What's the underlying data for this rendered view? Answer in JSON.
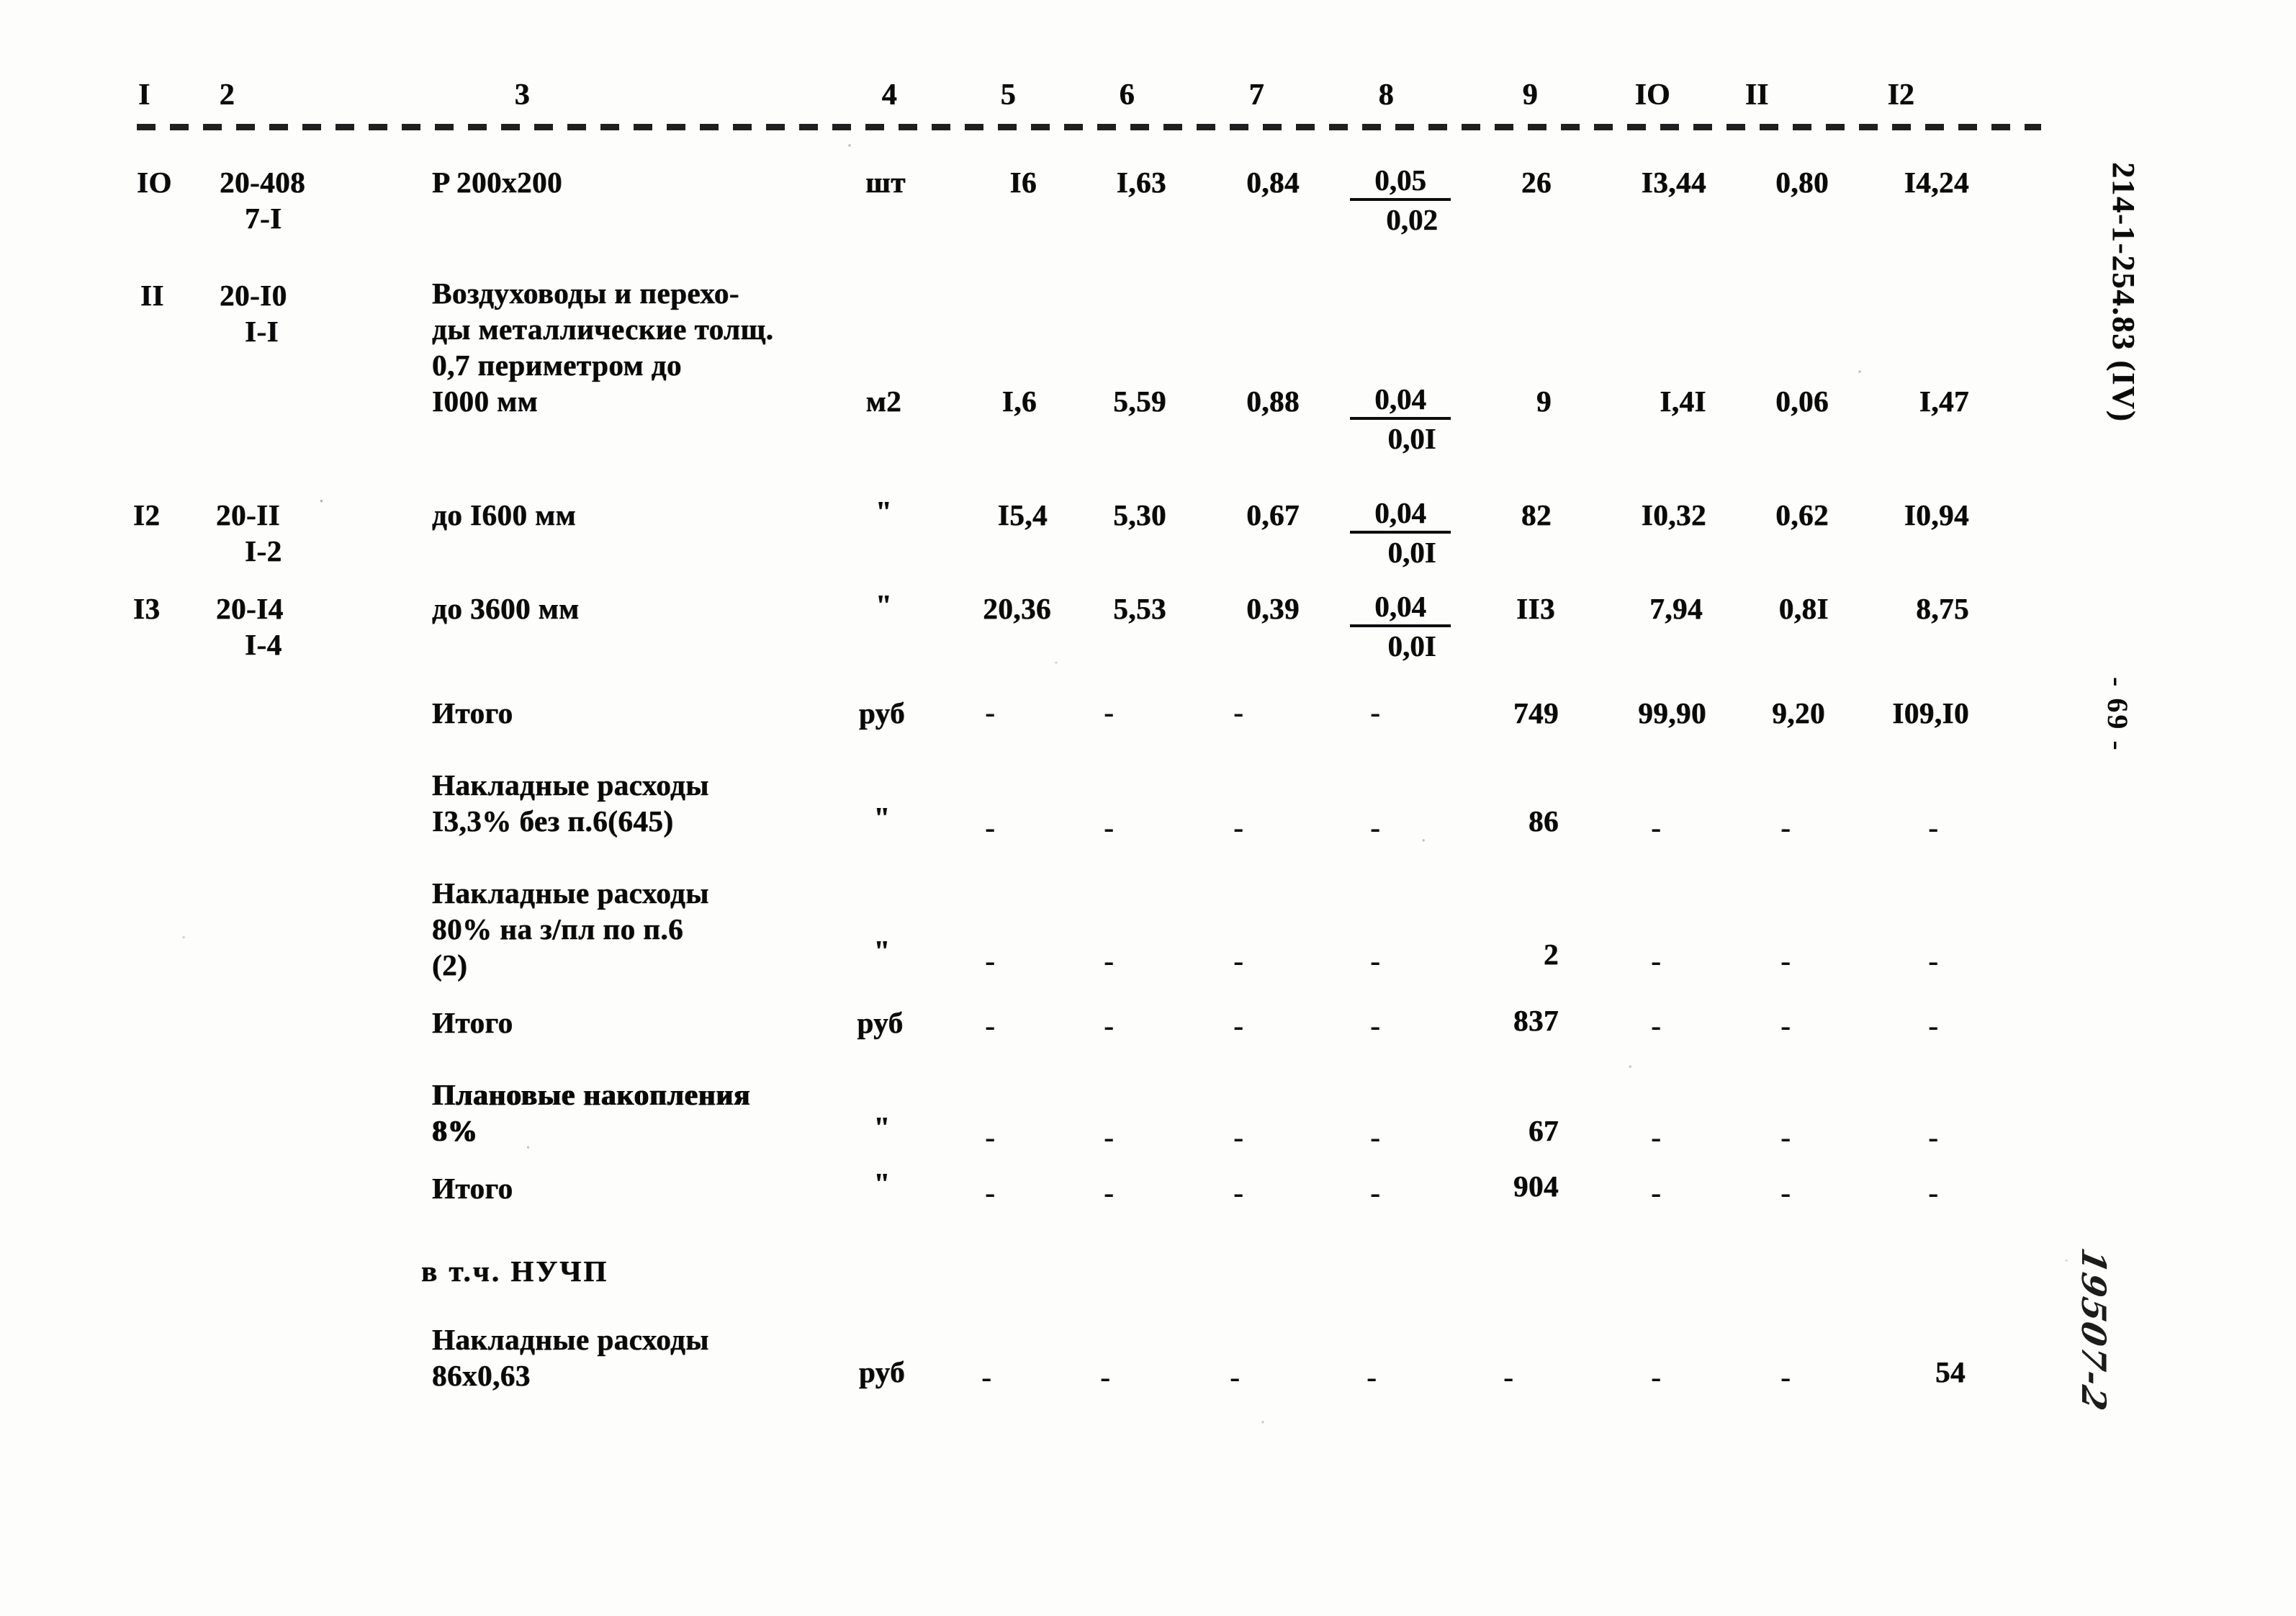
{
  "document": {
    "side_code": "214-1-254.83 (IV)",
    "page_marker": "- 69 -",
    "handwritten_note": "19507-2"
  },
  "table": {
    "column_headers": [
      "I",
      "2",
      "3",
      "4",
      "5",
      "6",
      "7",
      "8",
      "9",
      "IO",
      "II",
      "I2"
    ],
    "rows": [
      {
        "no": "IO",
        "code_line1": "20-408",
        "code_line2": "7-I",
        "name": [
          "P 200x200"
        ],
        "unit": "шт",
        "c5": "I6",
        "c6": "I,63",
        "c7": "0,84",
        "c8_top": "0,05",
        "c8_bot": "0,02",
        "c9": "26",
        "c10": "I3,44",
        "c11": "0,80",
        "c12": "I4,24"
      },
      {
        "no": "II",
        "code_line1": "20-I0",
        "code_line2": "I-I",
        "name": [
          "Воздуховоды и перехо-",
          "ды металлические толщ.",
          "0,7 периметром до",
          "I000 мм"
        ],
        "unit": "м2",
        "c5": "I,6",
        "c6": "5,59",
        "c7": "0,88",
        "c8_top": "0,04",
        "c8_bot": "0,0I",
        "c9": "9",
        "c10": "I,4I",
        "c11": "0,06",
        "c12": "I,47"
      },
      {
        "no": "I2",
        "code_line1": "20-II",
        "code_line2": "I-2",
        "name": [
          "до I600 мм"
        ],
        "unit": "\"",
        "c5": "I5,4",
        "c6": "5,30",
        "c7": "0,67",
        "c8_top": "0,04",
        "c8_bot": "0,0I",
        "c9": "82",
        "c10": "I0,32",
        "c11": "0,62",
        "c12": "I0,94"
      },
      {
        "no": "I3",
        "code_line1": "20-I4",
        "code_line2": "I-4",
        "name": [
          "до 3600 мм"
        ],
        "unit": "\"",
        "c5": "20,36",
        "c6": "5,53",
        "c7": "0,39",
        "c8_top": "0,04",
        "c8_bot": "0,0I",
        "c9": "II3",
        "c10": "7,94",
        "c11": "0,8I",
        "c12": "8,75"
      }
    ],
    "summary_rows": [
      {
        "name": [
          "Итого"
        ],
        "unit": "руб",
        "c5": "-",
        "c6": "-",
        "c7": "-",
        "c8": "-",
        "c9": "749",
        "c10": "99,90",
        "c11": "9,20",
        "c12": "I09,I0"
      },
      {
        "name": [
          "Накладные расходы",
          "I3,3% без п.6(645)"
        ],
        "unit": "\"",
        "c5": "-",
        "c6": "-",
        "c7": "-",
        "c8": "-",
        "c9": "86",
        "c10": "-",
        "c11": "-",
        "c12": "-"
      },
      {
        "name": [
          "Накладные расходы",
          "80% на з/пл по п.6",
          "(2)"
        ],
        "unit": "\"",
        "c5": "-",
        "c6": "-",
        "c7": "-",
        "c8": "-",
        "c9": "2",
        "c10": "-",
        "c11": "-",
        "c12": "-"
      },
      {
        "name": [
          "Итого"
        ],
        "unit": "руб",
        "c5": "-",
        "c6": "-",
        "c7": "-",
        "c8": "-",
        "c9": "837",
        "c10": "-",
        "c11": "-",
        "c12": "-"
      },
      {
        "name": [
          "Плановые накопления",
          "8%"
        ],
        "unit": "\"",
        "c5": "-",
        "c6": "-",
        "c7": "-",
        "c8": "-",
        "c9": "67",
        "c10": "-",
        "c11": "-",
        "c12": "-"
      },
      {
        "name": [
          "Итого"
        ],
        "unit": "\"",
        "c5": "-",
        "c6": "-",
        "c7": "-",
        "c8": "-",
        "c9": "904",
        "c10": "-",
        "c11": "-",
        "c12": "-"
      }
    ],
    "footer_label": "в т.ч. НУЧП",
    "footer_row": {
      "name": [
        "Накладные расходы",
        "86х0,63"
      ],
      "unit": "руб",
      "c5": "-",
      "c6": "-",
      "c7": "-",
      "c8": "-",
      "c9": "-",
      "c10": "-",
      "c11": "-",
      "c12": "54"
    }
  }
}
